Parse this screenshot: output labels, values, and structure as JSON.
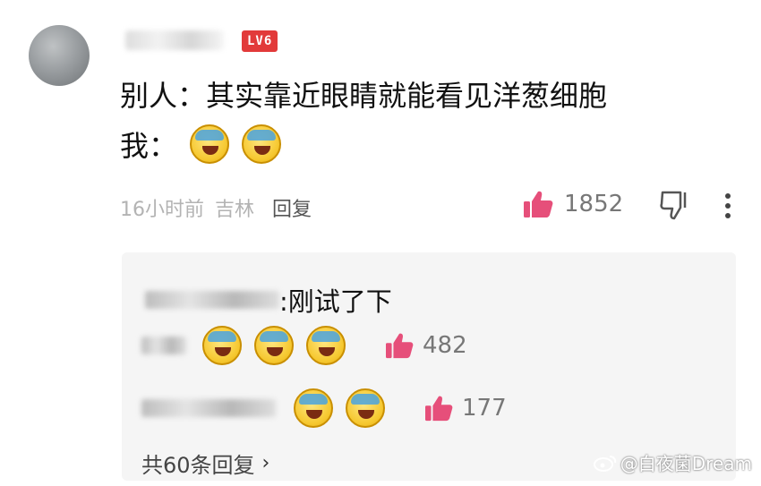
{
  "comment": {
    "level_badge": "LV6",
    "line1": "别人：其实靠近眼睛就能看见洋葱细胞",
    "line2_prefix": "我：",
    "time": "16小时前",
    "location": "吉林",
    "reply_label": "回复",
    "like_count": "1852"
  },
  "replies": [
    {
      "text": ":刚试了下"
    },
    {
      "like_count": "482"
    },
    {
      "like_count": "177"
    }
  ],
  "replies_total": "共60条回复",
  "watermark": "@白夜菌Dream",
  "icons": [
    "avatar",
    "thumb-up-icon",
    "thumb-down-icon",
    "more-icon",
    "laugh-cry-emoji",
    "chevron-right-icon",
    "weibo-icon"
  ],
  "colors": {
    "accent_like": "#e64f7a",
    "badge": "#e23a3a",
    "reply_bg": "#f5f5f5"
  }
}
